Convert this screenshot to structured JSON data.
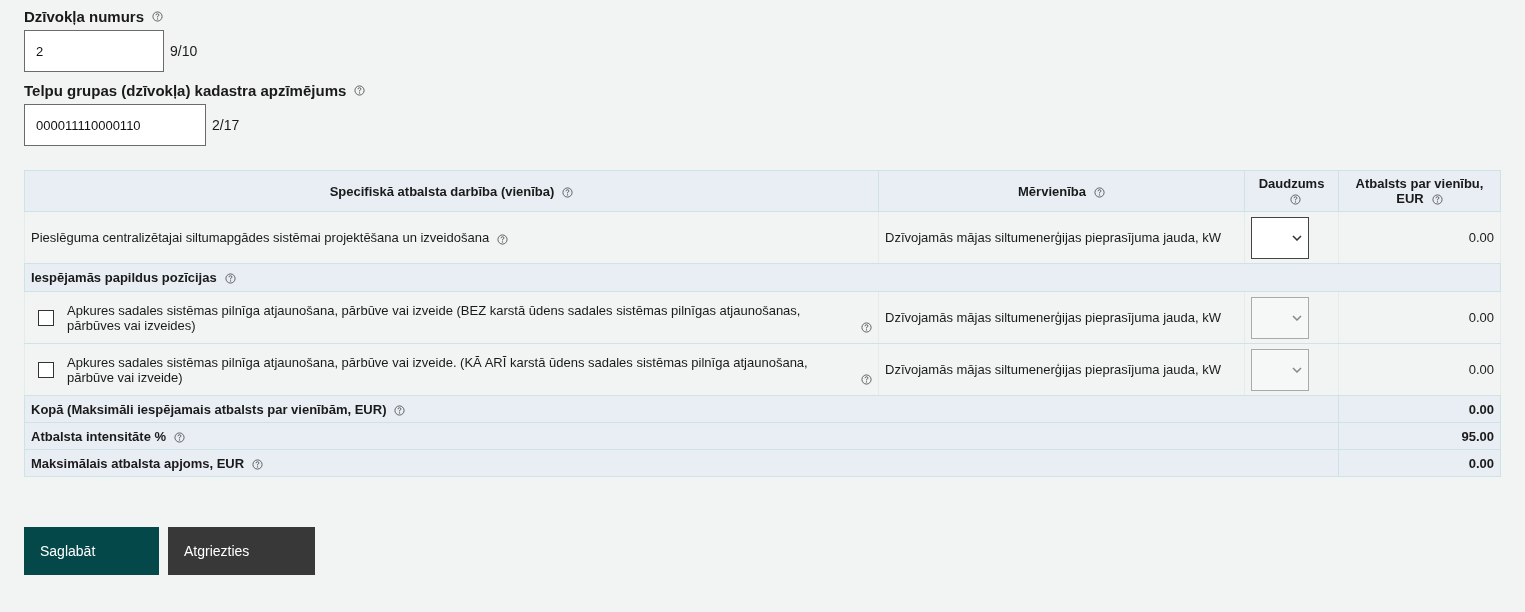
{
  "fields": [
    {
      "label": "Dzīvokļa numurs",
      "value": "2",
      "counter": "9/10"
    },
    {
      "label": "Telpu grupas (dzīvokļa) kadastra apzīmējums",
      "value": "000011110000110",
      "counter": "2/17"
    }
  ],
  "table": {
    "columns": [
      {
        "label": "Specifiskā atbalsta darbība (vienība)"
      },
      {
        "label": "Mērvienība"
      },
      {
        "label": "Daudzums"
      },
      {
        "label": "Atbalsts par vienību, EUR"
      }
    ],
    "rows": [
      {
        "kind": "item",
        "text": "Pieslēguma centralizētajai siltumapgādes sistēmai projektēšana un izveidošana",
        "unit": "Dzīvojamās mājas siltumenerģijas pieprasījuma jauda, kW",
        "quantity_disabled": false,
        "value": "0.00"
      },
      {
        "kind": "group",
        "text": "Iespējamās papildus pozīcijas"
      },
      {
        "kind": "option",
        "checked": false,
        "text": "Apkures sadales sistēmas pilnīga atjaunošana, pārbūve vai izveide (BEZ karstā ūdens sadales sistēmas pilnīgas atjaunošanas, pārbūves vai izveides)",
        "unit": "Dzīvojamās mājas siltumenerģijas pieprasījuma jauda, kW",
        "quantity_disabled": true,
        "value": "0.00"
      },
      {
        "kind": "option",
        "checked": false,
        "text": "Apkures sadales sistēmas pilnīga atjaunošana, pārbūve vai izveide. (KĀ ARĪ karstā ūdens sadales sistēmas pilnīga atjaunošana, pārbūve vai izveide)",
        "unit": "Dzīvojamās mājas siltumenerģijas pieprasījuma jauda, kW",
        "quantity_disabled": true,
        "value": "0.00"
      }
    ],
    "summary": [
      {
        "label": "Kopā (Maksimāli iespējamais atbalsts par vienībām, EUR)",
        "value": "0.00"
      },
      {
        "label": "Atbalsta intensitāte %",
        "value": "95.00"
      },
      {
        "label": "Maksimālais atbalsta apjoms, EUR",
        "value": "0.00"
      }
    ]
  },
  "buttons": [
    {
      "label": "Saglabāt",
      "kind": "primary"
    },
    {
      "label": "Atgriezties",
      "kind": "secondary"
    }
  ]
}
